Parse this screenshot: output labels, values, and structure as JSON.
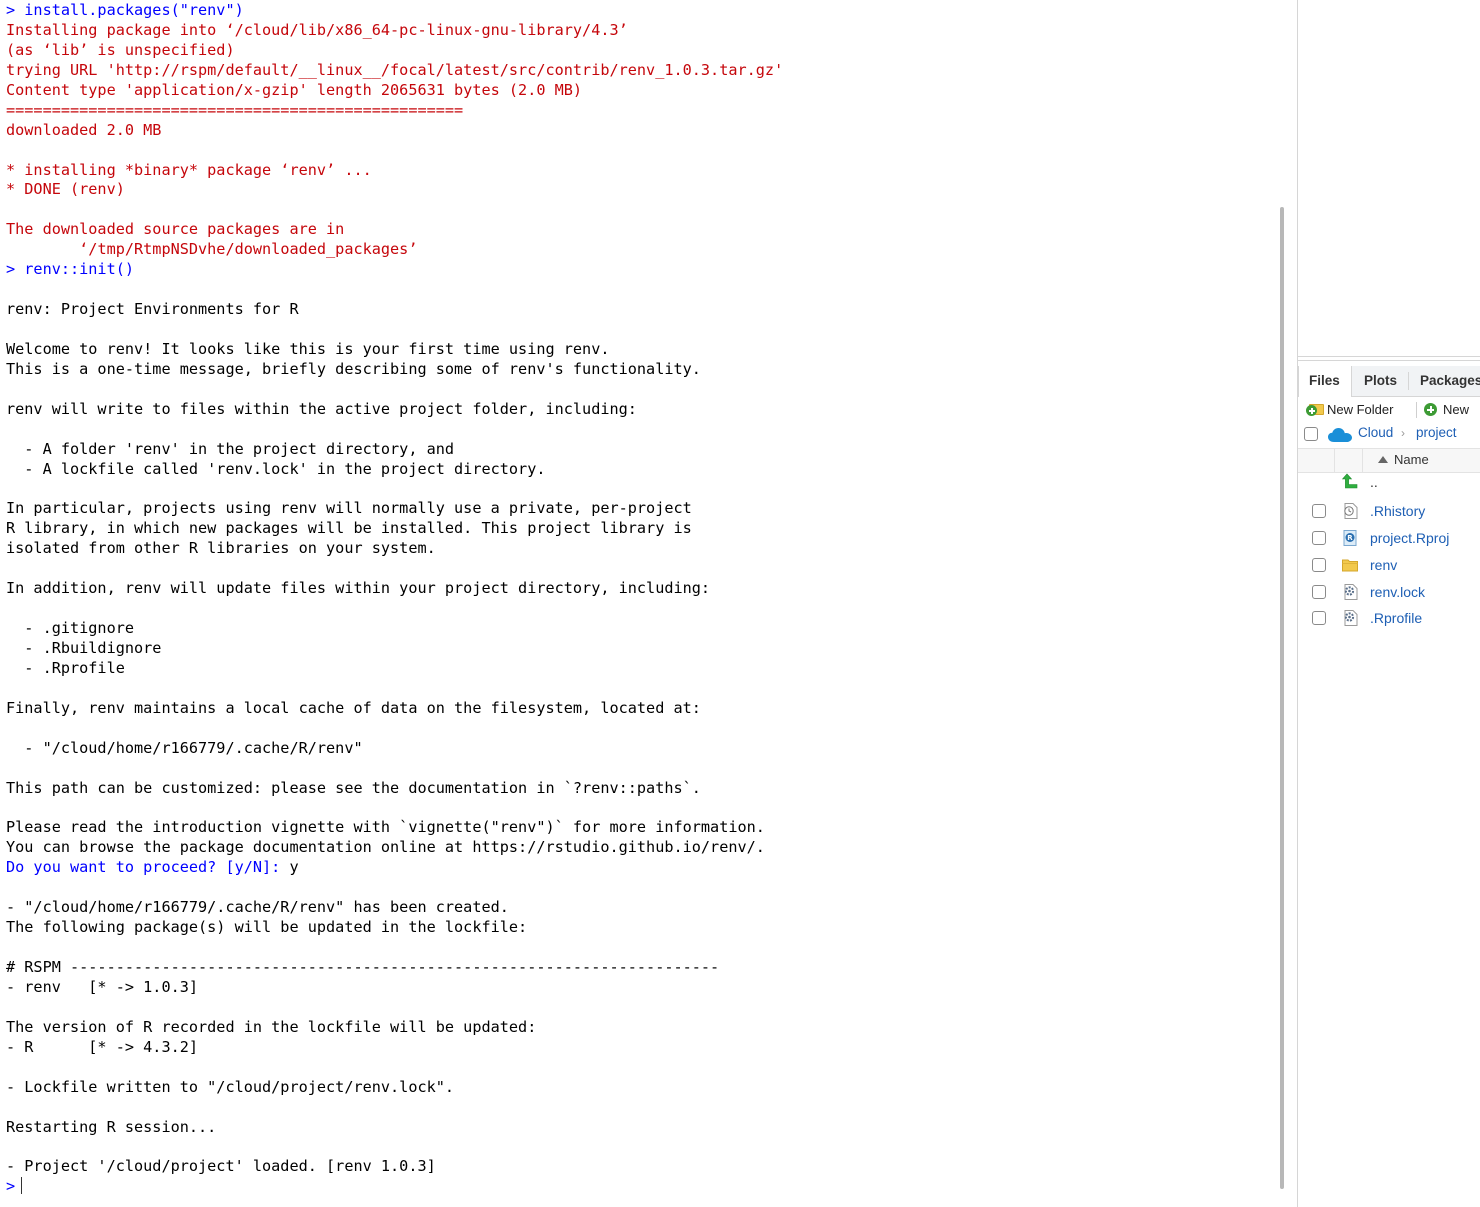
{
  "console": {
    "lines": [
      {
        "text": "> install.packages(\"renv\")",
        "style": "cmd"
      },
      {
        "text": "Installing package into ‘/cloud/lib/x86_64-pc-linux-gnu-library/4.3’",
        "style": "err"
      },
      {
        "text": "(as ‘lib’ is unspecified)",
        "style": "err"
      },
      {
        "text": "trying URL 'http://rspm/default/__linux__/focal/latest/src/contrib/renv_1.0.3.tar.gz'",
        "style": "err"
      },
      {
        "text": "Content type 'application/x-gzip' length 2065631 bytes (2.0 MB)",
        "style": "err"
      },
      {
        "text": "==================================================",
        "style": "err"
      },
      {
        "text": "downloaded 2.0 MB",
        "style": "err"
      },
      {
        "text": "",
        "style": "out"
      },
      {
        "text": "* installing *binary* package ‘renv’ ...",
        "style": "err"
      },
      {
        "text": "* DONE (renv)",
        "style": "err"
      },
      {
        "text": "",
        "style": "out"
      },
      {
        "text": "The downloaded source packages are in",
        "style": "err"
      },
      {
        "text": "\t‘/tmp/RtmpNSDvhe/downloaded_packages’",
        "style": "err"
      },
      {
        "text": "> renv::init()",
        "style": "cmd"
      },
      {
        "text": "",
        "style": "out"
      },
      {
        "text": "renv: Project Environments for R",
        "style": "out"
      },
      {
        "text": "",
        "style": "out"
      },
      {
        "text": "Welcome to renv! It looks like this is your first time using renv.",
        "style": "out"
      },
      {
        "text": "This is a one-time message, briefly describing some of renv's functionality.",
        "style": "out"
      },
      {
        "text": "",
        "style": "out"
      },
      {
        "text": "renv will write to files within the active project folder, including:",
        "style": "out"
      },
      {
        "text": "",
        "style": "out"
      },
      {
        "text": "  - A folder 'renv' in the project directory, and",
        "style": "out"
      },
      {
        "text": "  - A lockfile called 'renv.lock' in the project directory.",
        "style": "out"
      },
      {
        "text": "",
        "style": "out"
      },
      {
        "text": "In particular, projects using renv will normally use a private, per-project",
        "style": "out"
      },
      {
        "text": "R library, in which new packages will be installed. This project library is",
        "style": "out"
      },
      {
        "text": "isolated from other R libraries on your system.",
        "style": "out"
      },
      {
        "text": "",
        "style": "out"
      },
      {
        "text": "In addition, renv will update files within your project directory, including:",
        "style": "out"
      },
      {
        "text": "",
        "style": "out"
      },
      {
        "text": "  - .gitignore",
        "style": "out"
      },
      {
        "text": "  - .Rbuildignore",
        "style": "out"
      },
      {
        "text": "  - .Rprofile",
        "style": "out"
      },
      {
        "text": "",
        "style": "out"
      },
      {
        "text": "Finally, renv maintains a local cache of data on the filesystem, located at:",
        "style": "out"
      },
      {
        "text": "",
        "style": "out"
      },
      {
        "text": "  - \"/cloud/home/r166779/.cache/R/renv\"",
        "style": "out"
      },
      {
        "text": "",
        "style": "out"
      },
      {
        "text": "This path can be customized: please see the documentation in `?renv::paths`.",
        "style": "out"
      },
      {
        "text": "",
        "style": "out"
      },
      {
        "text": "Please read the introduction vignette with `vignette(\"renv\")` for more information.",
        "style": "out"
      },
      {
        "text": "You can browse the package documentation online at https://rstudio.github.io/renv/.",
        "style": "out"
      },
      {
        "text": "Do you want to proceed? [y/N]: ",
        "style": "prompt",
        "input": "y"
      },
      {
        "text": "",
        "style": "out"
      },
      {
        "text": "- \"/cloud/home/r166779/.cache/R/renv\" has been created.",
        "style": "out"
      },
      {
        "text": "The following package(s) will be updated in the lockfile:",
        "style": "out"
      },
      {
        "text": "",
        "style": "out"
      },
      {
        "text": "# RSPM -----------------------------------------------------------------------",
        "style": "out"
      },
      {
        "text": "- renv   [* -> 1.0.3]",
        "style": "out"
      },
      {
        "text": "",
        "style": "out"
      },
      {
        "text": "The version of R recorded in the lockfile will be updated:",
        "style": "out"
      },
      {
        "text": "- R      [* -> 4.3.2]",
        "style": "out"
      },
      {
        "text": "",
        "style": "out"
      },
      {
        "text": "- Lockfile written to \"/cloud/project/renv.lock\".",
        "style": "out"
      },
      {
        "text": "",
        "style": "out"
      },
      {
        "text": "Restarting R session...",
        "style": "out"
      },
      {
        "text": "",
        "style": "out"
      },
      {
        "text": "- Project '/cloud/project' loaded. [renv 1.0.3]",
        "style": "out"
      },
      {
        "text": ">",
        "style": "cmd",
        "caret": true
      }
    ]
  },
  "files_pane": {
    "tabs": [
      {
        "label": "Files",
        "active": true
      },
      {
        "label": "Plots",
        "active": false
      },
      {
        "label": "Packages",
        "active": false
      }
    ],
    "toolbar": {
      "new_folder": "New Folder",
      "new_file": "New"
    },
    "breadcrumb": {
      "root": "Cloud",
      "separator": "›",
      "current": "project"
    },
    "column_header": "Name",
    "parent_link": "..",
    "files": [
      {
        "name": ".Rhistory",
        "icon": "history-file-icon"
      },
      {
        "name": "project.Rproj",
        "icon": "rproj-file-icon"
      },
      {
        "name": "renv",
        "icon": "folder-icon"
      },
      {
        "name": "renv.lock",
        "icon": "settings-file-icon"
      },
      {
        "name": ".Rprofile",
        "icon": "settings-file-icon"
      }
    ]
  },
  "colors": {
    "command": "#0000ff",
    "message": "#c5060b",
    "output": "#000000",
    "link": "#1e5fb4",
    "folder": "#f2c94c",
    "add_green": "#3d9b35",
    "cloud_blue": "#1a8fd8"
  }
}
